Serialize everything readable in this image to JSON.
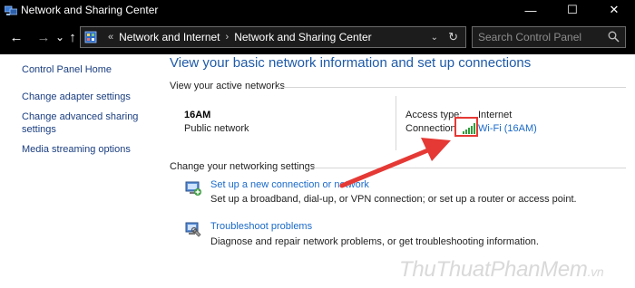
{
  "window": {
    "title": "Network and Sharing Center",
    "controls": {
      "minimize": "—",
      "maximize": "☐",
      "close": "✕"
    }
  },
  "addressbar": {
    "back": "←",
    "forward": "→",
    "recent": "⌄",
    "up": "↑",
    "breadcrumb": [
      "Network and Internet",
      "Network and Sharing Center"
    ],
    "search_placeholder": "Search Control Panel"
  },
  "sidebar": {
    "home": "Control Panel Home",
    "tasks": [
      {
        "label": "Change adapter settings"
      },
      {
        "label": "Change advanced sharing settings"
      },
      {
        "label": "Media streaming options"
      }
    ]
  },
  "main": {
    "title": "View your basic network information and set up connections",
    "active_networks_label": "View your active networks",
    "network": {
      "name": "16AM",
      "category": "Public network",
      "access_type_label": "Access type:",
      "access_type_value": "Internet",
      "connections_label": "Connections:",
      "connection_value": "Wi-Fi (16AM)"
    },
    "change_settings_label": "Change your networking settings",
    "settings": [
      {
        "icon": "new-connection-icon",
        "link": "Set up a new connection or network",
        "desc": "Set up a broadband, dial-up, or VPN connection; or set up a router or access point."
      },
      {
        "icon": "troubleshoot-icon",
        "link": "Troubleshoot problems",
        "desc": "Diagnose and repair network problems, or get troubleshooting information."
      }
    ]
  },
  "annotation": {
    "arrow_color": "#e53935",
    "box_color": "#e53935"
  },
  "watermark": {
    "main": "ThuThuatPhanMem",
    "suffix": ".vn"
  },
  "colors": {
    "title_blue": "#1e5aa8",
    "link_blue": "#1a6ac9",
    "titlebar": "#000000",
    "wifi_green": "#2e9e3a"
  }
}
